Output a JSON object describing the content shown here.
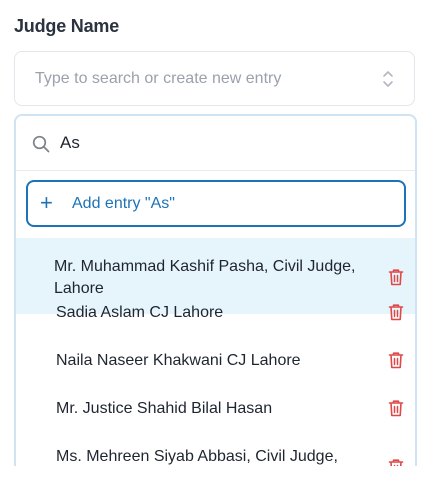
{
  "field": {
    "label": "Judge Name",
    "placeholder": "Type to search or create new entry"
  },
  "search": {
    "value": "As"
  },
  "add_entry": {
    "label": "Add entry \"As\""
  },
  "options": [
    {
      "label": "Mr. Muhammad Kashif Pasha, Civil Judge, Lahore"
    },
    {
      "label": "Sadia Aslam CJ Lahore"
    },
    {
      "label": "Naila Naseer Khakwani CJ Lahore"
    },
    {
      "label": "Mr. Justice Shahid Bilal Hasan"
    },
    {
      "label": "Ms. Mehreen Siyab Abbasi, Civil Judge,"
    }
  ],
  "colors": {
    "accent": "#1e73b6",
    "highlight": "#e6f4fc",
    "delete": "#e04848"
  }
}
